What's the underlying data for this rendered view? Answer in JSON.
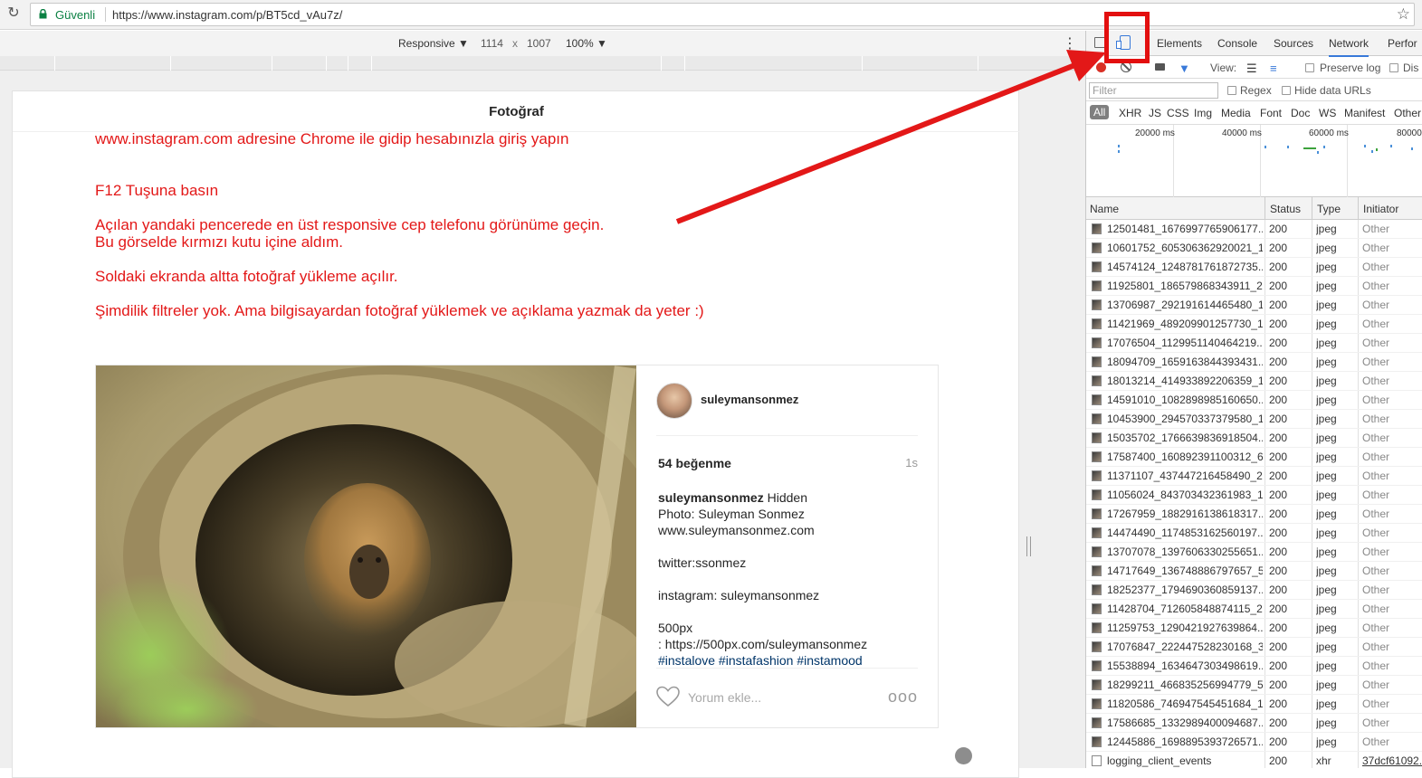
{
  "browser": {
    "secure_label": "Güvenli",
    "url": "https://www.instagram.com/p/BT5cd_vAu7z/"
  },
  "device_toolbar": {
    "device": "Responsive ▼",
    "width": "1114",
    "times": "x",
    "height": "1007",
    "zoom": "100% ▼"
  },
  "page": {
    "title": "Fotoğraf",
    "instructions": [
      "www.instagram.com adresine Chrome ile gidip hesabınızla giriş yapın",
      "F12 Tuşuna basın",
      "Açılan yandaki pencerede en üst responsive cep telefonu görünüme geçin.",
      "Bu görselde kırmızı kutu içine aldım.",
      "Soldaki ekranda altta fotoğraf yükleme açılır.",
      "Şimdilik filtreler yok. Ama bilgisayardan fotoğraf yüklemek ve açıklama yazmak da yeter :)"
    ]
  },
  "post": {
    "username": "suleymansonmez",
    "likes": "54 beğenme",
    "time": "1s",
    "caption_user": "suleymansonmez",
    "caption_text": " Hidden\nPhoto: Suleyman Sonmez\nwww.suleymansonmez.com\n\ntwitter:ssonmez\n\ninstagram: suleymansonmez\n\n500px\n: https://500px.com/suleymansonmez\n",
    "caption_tags": "#instalove  #instafashion #instamood",
    "comment_placeholder": "Yorum ekle...",
    "more": "ooo"
  },
  "devtools": {
    "tabs": [
      "Elements",
      "Console",
      "Sources",
      "Network",
      "Perfor"
    ],
    "view_label": "View:",
    "preserve_log": "Preserve log",
    "disable_cache": "Dis",
    "filter_placeholder": "Filter",
    "regex": "Regex",
    "hide_data_urls": "Hide data URLs",
    "types": [
      "All",
      "XHR",
      "JS",
      "CSS",
      "Img",
      "Media",
      "Font",
      "Doc",
      "WS",
      "Manifest",
      "Other"
    ],
    "overview_labels": [
      "20000 ms",
      "40000 ms",
      "60000 ms",
      "80000"
    ],
    "columns": [
      "Name",
      "Status",
      "Type",
      "Initiator"
    ],
    "requests": [
      {
        "name": "12501481_1676997765906177...",
        "status": "200",
        "type": "jpeg",
        "initiator": "Other"
      },
      {
        "name": "10601752_605306362920021_1...",
        "status": "200",
        "type": "jpeg",
        "initiator": "Other"
      },
      {
        "name": "14574124_1248781761872735...",
        "status": "200",
        "type": "jpeg",
        "initiator": "Other"
      },
      {
        "name": "11925801_186579868343911_2...",
        "status": "200",
        "type": "jpeg",
        "initiator": "Other"
      },
      {
        "name": "13706987_292191614465480_1...",
        "status": "200",
        "type": "jpeg",
        "initiator": "Other"
      },
      {
        "name": "11421969_489209901257730_1...",
        "status": "200",
        "type": "jpeg",
        "initiator": "Other"
      },
      {
        "name": "17076504_1129951140464219...",
        "status": "200",
        "type": "jpeg",
        "initiator": "Other"
      },
      {
        "name": "18094709_1659163844393431...",
        "status": "200",
        "type": "jpeg",
        "initiator": "Other"
      },
      {
        "name": "18013214_414933892206359_1...",
        "status": "200",
        "type": "jpeg",
        "initiator": "Other"
      },
      {
        "name": "14591010_1082898985160650...",
        "status": "200",
        "type": "jpeg",
        "initiator": "Other"
      },
      {
        "name": "10453900_294570337379580_1...",
        "status": "200",
        "type": "jpeg",
        "initiator": "Other"
      },
      {
        "name": "15035702_1766639836918504...",
        "status": "200",
        "type": "jpeg",
        "initiator": "Other"
      },
      {
        "name": "17587400_160892391100312_6...",
        "status": "200",
        "type": "jpeg",
        "initiator": "Other"
      },
      {
        "name": "11371107_437447216458490_2...",
        "status": "200",
        "type": "jpeg",
        "initiator": "Other"
      },
      {
        "name": "11056024_843703432361983_1...",
        "status": "200",
        "type": "jpeg",
        "initiator": "Other"
      },
      {
        "name": "17267959_1882916138618317...",
        "status": "200",
        "type": "jpeg",
        "initiator": "Other"
      },
      {
        "name": "14474490_1174853162560197...",
        "status": "200",
        "type": "jpeg",
        "initiator": "Other"
      },
      {
        "name": "13707078_1397606330255651...",
        "status": "200",
        "type": "jpeg",
        "initiator": "Other"
      },
      {
        "name": "14717649_136748886797657_5...",
        "status": "200",
        "type": "jpeg",
        "initiator": "Other"
      },
      {
        "name": "18252377_1794690360859137...",
        "status": "200",
        "type": "jpeg",
        "initiator": "Other"
      },
      {
        "name": "11428704_712605848874115_2...",
        "status": "200",
        "type": "jpeg",
        "initiator": "Other"
      },
      {
        "name": "11259753_1290421927639864...",
        "status": "200",
        "type": "jpeg",
        "initiator": "Other"
      },
      {
        "name": "17076847_222447528230168_3...",
        "status": "200",
        "type": "jpeg",
        "initiator": "Other"
      },
      {
        "name": "15538894_1634647303498619...",
        "status": "200",
        "type": "jpeg",
        "initiator": "Other"
      },
      {
        "name": "18299211_466835256994779_5...",
        "status": "200",
        "type": "jpeg",
        "initiator": "Other"
      },
      {
        "name": "11820586_746947545451684_1...",
        "status": "200",
        "type": "jpeg",
        "initiator": "Other"
      },
      {
        "name": "17586685_1332989400094687...",
        "status": "200",
        "type": "jpeg",
        "initiator": "Other"
      },
      {
        "name": "12445886_1698895393726571...",
        "status": "200",
        "type": "jpeg",
        "initiator": "Other"
      },
      {
        "name": "logging_client_events",
        "status": "200",
        "type": "xhr",
        "initiator": "37dcf61092..."
      }
    ]
  },
  "colors": {
    "annotation_red": "#e31818",
    "accent_blue": "#3879d9"
  }
}
